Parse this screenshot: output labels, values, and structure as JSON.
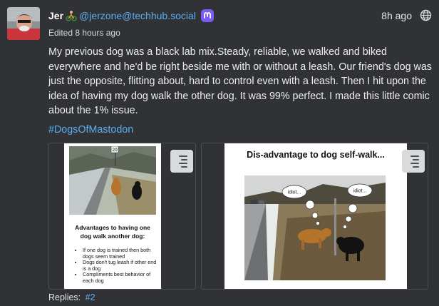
{
  "post": {
    "display_name": "Jer",
    "name_emoji": "biker-emoji",
    "handle": "@jerzone@techhub.social",
    "server_badge": "mastodon-icon",
    "timestamp": "8h ago",
    "visibility_icon": "globe-icon",
    "edited": "Edited 8 hours ago",
    "body": "My previous dog was a black lab mix.Steady, reliable, we walked and biked everywhere and he'd be right beside me with or without a leash. Our friend's dog was just the opposite, flitting about, hard to control even with a leash. Then I hit upon the idea of having my dog walk the other dog. It was 99% perfect. I made this little comic about the 1% issue.",
    "hashtag": "#DogsOfMastodon"
  },
  "media": [
    {
      "photo_sign": "20",
      "title": "Advantages to having one dog walk another dog:",
      "bullets": [
        "If one dog is trained then both dogs seem trained",
        "Dogs don't tug leash if other end is a dog",
        "Compliments best behavior of each dog"
      ],
      "alt_icon": "alt-text-icon"
    },
    {
      "title": "Dis-advantage to dog self-walk...",
      "bubble_left": "idiot...",
      "bubble_right": "idiot...",
      "alt_icon": "alt-text-icon"
    }
  ],
  "replies": {
    "label": "Replies:",
    "count": "#2"
  },
  "colors": {
    "background": "#303236",
    "link": "#5aaef0",
    "mastodon_badge": "#7b5cf5"
  }
}
